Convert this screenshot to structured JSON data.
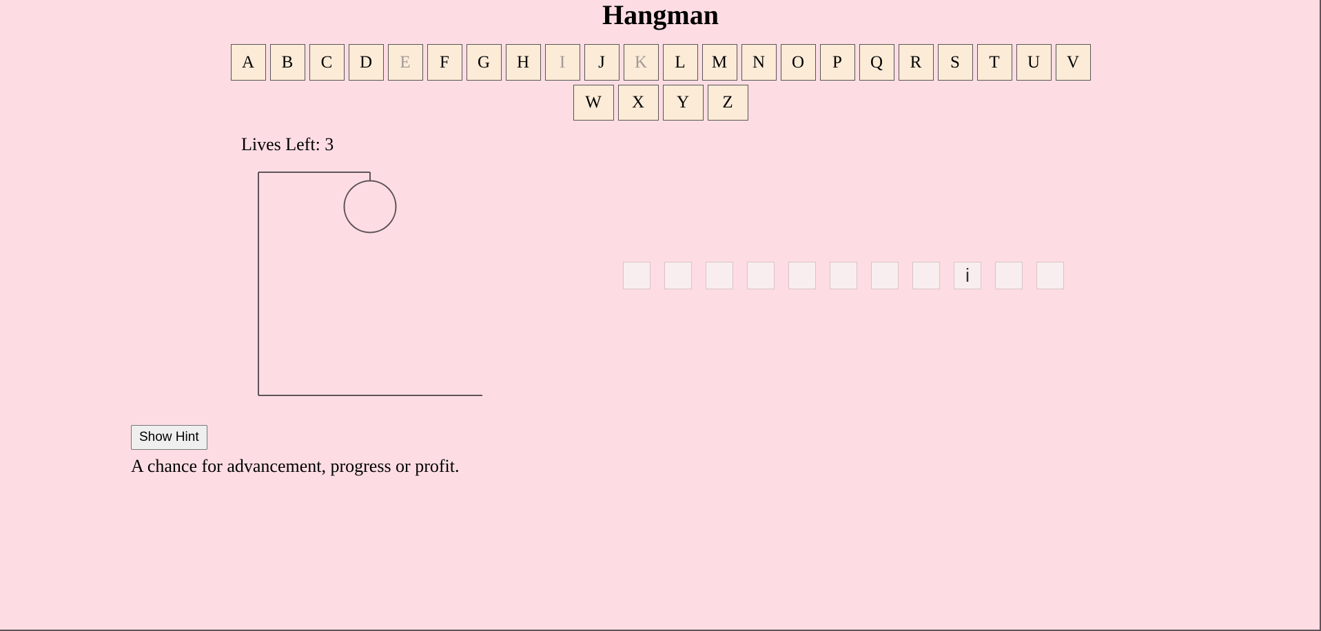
{
  "title": "Hangman",
  "keyboard": {
    "row1": [
      {
        "letter": "A",
        "used": false
      },
      {
        "letter": "B",
        "used": false
      },
      {
        "letter": "C",
        "used": false
      },
      {
        "letter": "D",
        "used": false
      },
      {
        "letter": "E",
        "used": true
      },
      {
        "letter": "F",
        "used": false
      },
      {
        "letter": "G",
        "used": false
      },
      {
        "letter": "H",
        "used": false
      },
      {
        "letter": "I",
        "used": true
      },
      {
        "letter": "J",
        "used": false
      },
      {
        "letter": "K",
        "used": true
      },
      {
        "letter": "L",
        "used": false
      },
      {
        "letter": "M",
        "used": false
      },
      {
        "letter": "N",
        "used": false
      },
      {
        "letter": "O",
        "used": false
      },
      {
        "letter": "P",
        "used": false
      },
      {
        "letter": "Q",
        "used": false
      },
      {
        "letter": "R",
        "used": false
      },
      {
        "letter": "S",
        "used": false
      },
      {
        "letter": "T",
        "used": false
      },
      {
        "letter": "U",
        "used": false
      },
      {
        "letter": "V",
        "used": false
      }
    ],
    "row2": [
      {
        "letter": "W",
        "used": false
      },
      {
        "letter": "X",
        "used": false
      },
      {
        "letter": "Y",
        "used": false
      },
      {
        "letter": "Z",
        "used": false
      }
    ]
  },
  "lives_text": "Lives Left: 3",
  "gallows": {
    "parts_drawn": [
      "base",
      "pole",
      "beam",
      "rope",
      "head"
    ]
  },
  "word_slots": [
    "",
    "",
    "",
    "",
    "",
    "",
    "",
    "",
    "i",
    "",
    ""
  ],
  "hint_button_label": "Show Hint",
  "hint_text": "A chance for advancement, progress or profit.",
  "colors": {
    "background": "#fddde3",
    "key_background": "#fcebd7",
    "used_key_text": "#a09a96",
    "drawing_stroke": "#5d5358"
  }
}
